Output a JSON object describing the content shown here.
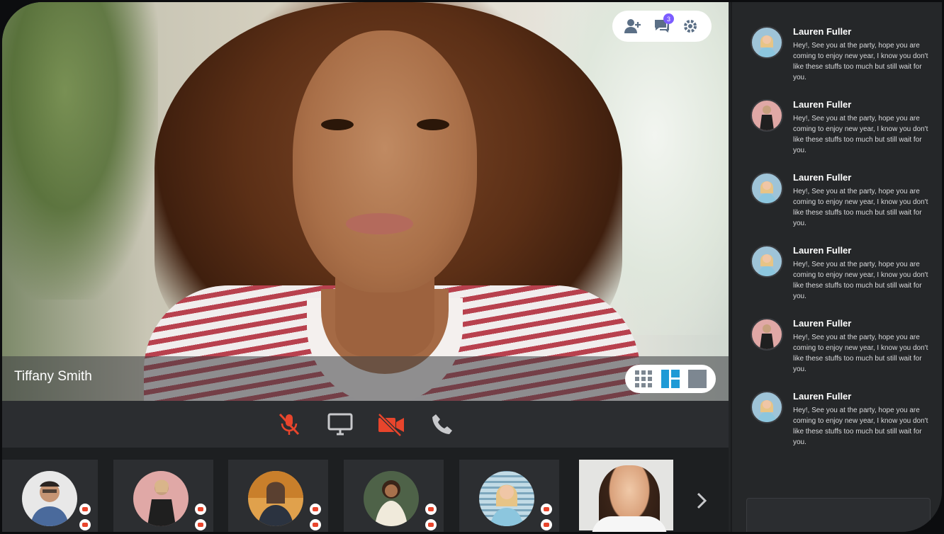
{
  "app": {
    "accent": "#e8452c",
    "brand_accent": "#7b5cff"
  },
  "video": {
    "speaker_name": "Tiffany Smith",
    "layout_modes": [
      "grid-icon",
      "split-layout-icon",
      "single-layout-icon"
    ],
    "active_layout": "split-layout-icon"
  },
  "top_actions": {
    "add_participant": "add-user-icon",
    "chat": "chat-icon",
    "chat_badge": "3",
    "settings": "gear-icon"
  },
  "controls": [
    {
      "name": "mic-muted-icon",
      "state": "off",
      "color": "#e8452c"
    },
    {
      "name": "screen-share-icon",
      "state": "idle",
      "color": "#c8c9cc"
    },
    {
      "name": "camera-off-icon",
      "state": "off",
      "color": "#e8452c"
    },
    {
      "name": "phone-icon",
      "state": "idle",
      "color": "#c8c9cc"
    }
  ],
  "participants": {
    "tiles": [
      {
        "avatar_bg": "#e8e8e8",
        "type": "avatar"
      },
      {
        "avatar_bg": "#e0a8a6",
        "type": "avatar"
      },
      {
        "avatar_bg": "#e0a14c",
        "type": "avatar"
      },
      {
        "avatar_bg": "#4e6248",
        "type": "avatar"
      },
      {
        "avatar_bg": "#9fc4d8",
        "type": "avatar"
      },
      {
        "avatar_bg": "#e4e4e2",
        "type": "live-video"
      }
    ],
    "next_icon": "chevron-right-icon"
  },
  "chat": {
    "messages": [
      {
        "sender": "Lauren Fuller",
        "text": "Hey!, See you at the party, hope you are coming to enjoy new year, I know you don't like these stuffs too much but still wait for you.",
        "avatar_bg": "#9fc4d8"
      },
      {
        "sender": "Lauren Fuller",
        "text": "Hey!, See you at the party, hope you are coming to enjoy new year, I know you don't like these stuffs too much but still wait for you.",
        "avatar_bg": "#e0a8a6"
      },
      {
        "sender": "Lauren Fuller",
        "text": "Hey!, See you at the party, hope you are coming to enjoy new year, I know you don't like these stuffs too much but still wait for you.",
        "avatar_bg": "#9fc4d8"
      },
      {
        "sender": "Lauren Fuller",
        "text": "Hey!, See you at the party, hope you are coming to enjoy new year, I know you don't like these stuffs too much but still wait for you.",
        "avatar_bg": "#9fc4d8"
      },
      {
        "sender": "Lauren Fuller",
        "text": "Hey!, See you at the party, hope you are coming to enjoy new year, I know you don't like these stuffs too much but still wait for you.",
        "avatar_bg": "#e0a8a6"
      },
      {
        "sender": "Lauren Fuller",
        "text": "Hey!, See you at the party, hope you are coming to enjoy new year, I know you don't like these stuffs too much but still wait for you.",
        "avatar_bg": "#9fc4d8"
      }
    ]
  }
}
